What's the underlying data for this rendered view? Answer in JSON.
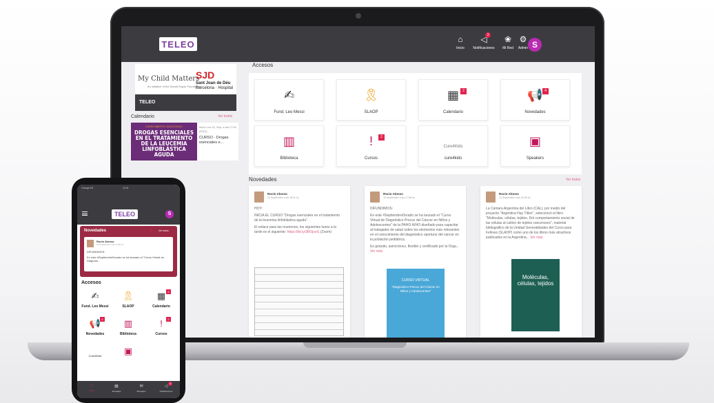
{
  "app": {
    "logo_text": "TELEO",
    "avatar_letter": "S"
  },
  "colors": {
    "accent": "#e0234e",
    "header": "#3c3c40",
    "avatar": "#b92bb4"
  },
  "nav": [
    {
      "icon": "home-icon",
      "glyph": "⌂",
      "label": "Inicio",
      "badge": ""
    },
    {
      "icon": "megaphone-icon",
      "glyph": "◁",
      "label": "Notificaciones",
      "badge": "3"
    },
    {
      "icon": "network-icon",
      "glyph": "❀",
      "label": "Mi Red",
      "badge": ""
    },
    {
      "icon": "gear-icon",
      "glyph": "⚙",
      "label": "Admin",
      "badge": ""
    }
  ],
  "sidebar": {
    "brand_line1": "My Child Matters",
    "brand_line2": "An initiative of the Sanofi Espoir Foundation",
    "sjd_logo": "SJD",
    "sjd_line1": "Sant Joan de Déu",
    "sjd_line2": "Barcelona · Hospital",
    "band_label": "TELEO",
    "calendar_title": "Calendario",
    "calendar_link": "Ver todos",
    "course": {
      "tag": "CURSO ABIERTO ONCOLÓGICO",
      "image_text": "DROGAS ESENCIALES EN EL TRATAMIENTO DE LA LEUCEMIA LINFOBLÁSTICA AGUDA",
      "meta": "Inicio Lun 20, Sep. a las 17:00 (2021)",
      "name": "CURSO - Drogas esenciales e..."
    }
  },
  "accesos": {
    "title": "Accesos",
    "tiles": [
      {
        "label": "Fund. Leo Messi",
        "icon": "signature-icon",
        "glyph": "✍",
        "color": "#333333",
        "badge": ""
      },
      {
        "label": "SLAOP",
        "icon": "ribbon-icon",
        "glyph": "🎗",
        "color": "#f0a020",
        "badge": ""
      },
      {
        "label": "Calendario",
        "icon": "calendar-icon",
        "glyph": "▦",
        "color": "#3c3c40",
        "badge": "2"
      },
      {
        "label": "Novedades",
        "icon": "speaker-icon",
        "glyph": "📢",
        "color": "#f0a020",
        "badge": "4"
      },
      {
        "label": "Biblioteca",
        "icon": "library-icon",
        "glyph": "▥",
        "color": "#c2185b",
        "badge": ""
      },
      {
        "label": "Cursos",
        "icon": "exclamation-icon",
        "glyph": "!",
        "color": "#c2185b",
        "badge": "2"
      },
      {
        "label": "cure4kids",
        "icon": "cure4kids-logo",
        "glyph": "Cure4Kids",
        "color": "#777777",
        "badge": ""
      },
      {
        "label": "Speakers",
        "icon": "presentation-icon",
        "glyph": "▣",
        "color": "#c2185b",
        "badge": ""
      }
    ]
  },
  "novedades": {
    "title": "Novedades",
    "link": "Ver todos",
    "posts": [
      {
        "author": "Rocío Alonso",
        "date": "15 Septiembre a las 18:01 hs",
        "heading": "HOY:",
        "body": "INICIA EL CURSO \"Drogas esenciales en el tratamiento de la leucemia linfoblástica aguda\".",
        "body2": "El enlace para las reuniones, los siguientes lunes a la tarde es el siguiente: ",
        "link": "https://bit.ly/3BOjsoG",
        "body3": " (Zoom)"
      },
      {
        "author": "Rocío Alonso",
        "date": "15 Septiembre a las 17:58 hs",
        "heading": "DIFUNDIMOS:",
        "body": "En este #SeptiembreDorado se ha lanzado el \"Curso Virtual de Diagnóstico Precoz del Cáncer en Niños y Adolescentes\" de la PAHO-WHO diseñado para capacitar al trabajador de salud sobre los elementos más relevantes en el conocimiento del diagnóstico oportuno del cáncer en la población pediátrica.",
        "body2": "Es gratuito, asincrónico, flexible y certificado por la Orga... ",
        "link": "Ver más",
        "poster_title": "CURSO VIRTUAL",
        "poster_sub": "\"Diagnóstico Precoz del Cáncer en Niños y Adolescentes\""
      },
      {
        "author": "Rocío Alonso",
        "date": "13 Septiembre a las 20:28 hs",
        "heading": "",
        "body": "La Cámara Argentina del Libro (CAL), por medio del proyecto \"Argentina Hay Títles\", seleccionó el libro \"Moléculas, células, tejidos. Del comportamiento social de las células al cultivo de tejidos cancerosos\", material bibliográfico de la Unidad Generalidades del Curso para Fellows (SLAOP) como uno de los libros más atractivos publicados en la Argentina... ",
        "body2": "",
        "link": "Ver más",
        "poster_title": "Moléculas, células, tejidos"
      }
    ]
  },
  "phone": {
    "status": "Orange ES",
    "time": "12:41",
    "novedades_title": "Novedades",
    "novedades_link": "Ver todos",
    "post": {
      "author": "Rocío Alonso",
      "date": "15 Septiembre a las 17:58 hs",
      "heading": "DIFUNDIMOS:",
      "body": "En este #SeptiembreDorado se ha lanzado el \"Curso Virtual de Diagnóst..."
    },
    "accesos_title": "Accesos",
    "tiles": [
      {
        "label": "Fund. Leo Messi",
        "glyph": "✍",
        "color": "#333333",
        "badge": ""
      },
      {
        "label": "SLAOP",
        "glyph": "🎗",
        "color": "#f0a020",
        "badge": ""
      },
      {
        "label": "Calendario",
        "glyph": "▦",
        "color": "#3c3c40",
        "badge": "2"
      },
      {
        "label": "Novedades",
        "glyph": "📢",
        "color": "#f0a020",
        "badge": "4"
      },
      {
        "label": "Biblioteca",
        "glyph": "▥",
        "color": "#c2185b",
        "badge": ""
      },
      {
        "label": "Cursos",
        "glyph": "!",
        "color": "#c2185b",
        "badge": "2"
      },
      {
        "label": "Cure4Kids",
        "glyph": "",
        "color": "#777777",
        "badge": ""
      },
      {
        "label": "",
        "glyph": "▣",
        "color": "#c2185b",
        "badge": ""
      }
    ],
    "tabs": [
      {
        "label": "Inicio",
        "glyph": "⌂",
        "icon": "home-icon",
        "badge": "",
        "active": true
      },
      {
        "label": "Mensajes",
        "glyph": "▤",
        "icon": "messages-icon",
        "badge": "",
        "active": false
      },
      {
        "label": "Mensajes",
        "glyph": "✉",
        "icon": "mail-icon",
        "badge": "",
        "active": false
      },
      {
        "label": "Notificaciones",
        "glyph": "◁",
        "icon": "megaphone-icon",
        "badge": "3",
        "active": false
      }
    ]
  }
}
